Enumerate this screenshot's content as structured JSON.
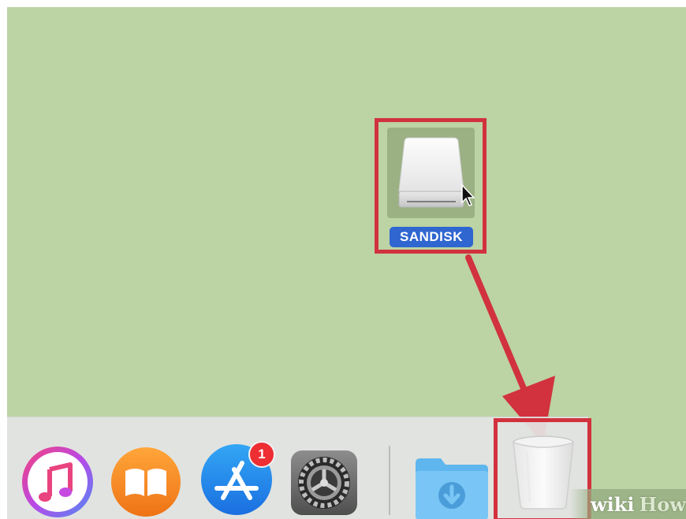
{
  "desktop": {
    "drive": {
      "label": "SANDISK",
      "icon": "external-drive-icon"
    },
    "instruction_arrow": {
      "from": "drive",
      "to": "trash",
      "color": "#d1323d"
    }
  },
  "dock": {
    "items": [
      {
        "name": "iTunes",
        "icon": "itunes-icon"
      },
      {
        "name": "iBooks",
        "icon": "ibooks-icon"
      },
      {
        "name": "App Store",
        "icon": "app-store-icon",
        "badge": "1"
      },
      {
        "name": "System Preferences",
        "icon": "gear-icon"
      },
      {
        "name": "Downloads",
        "icon": "downloads-folder-icon"
      },
      {
        "name": "Trash",
        "icon": "trash-icon"
      }
    ]
  },
  "colors": {
    "desktop_background": "#bcd3a4",
    "highlight": "#d1323d",
    "selection_label": "#2f66d0",
    "badge": "#ee2e33"
  },
  "watermark": {
    "wiki": "wiki",
    "how": "How"
  }
}
